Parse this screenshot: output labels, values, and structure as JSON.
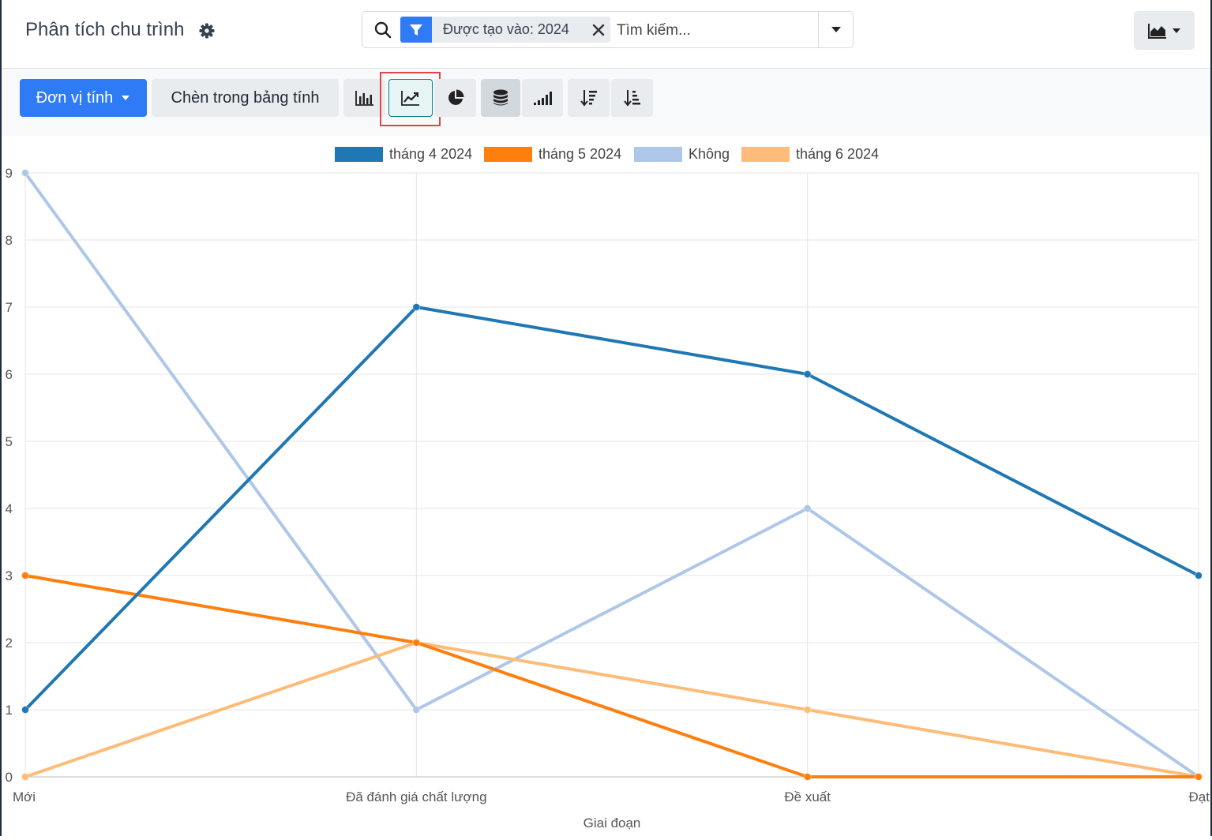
{
  "header": {
    "title": "Phân tích chu trình",
    "search": {
      "facet_label": "Được tạo vào: 2024",
      "placeholder": "Tìm kiếm..."
    }
  },
  "toolbar": {
    "measures_label": "Đơn vị tính",
    "insert_label": "Chèn trong bảng tính"
  },
  "colors": {
    "primary": "#2f7bf6",
    "selected_border": "#017e84",
    "highlight": "#e0454a"
  },
  "chart_data": {
    "type": "line",
    "xlabel": "Giai đoạn",
    "ylabel": "",
    "ylim": [
      0,
      9
    ],
    "yticks": [
      0,
      1,
      2,
      3,
      4,
      5,
      6,
      7,
      8,
      9
    ],
    "categories": [
      "Mới",
      "Đã đánh giá chất lượng",
      "Đề xuất",
      "Đạt"
    ],
    "legend_position": "top-center",
    "grid": true,
    "series": [
      {
        "name": "tháng 4 2024",
        "color": "#1f77b4",
        "values": [
          1,
          7,
          6,
          3
        ]
      },
      {
        "name": "tháng 5 2024",
        "color": "#ff7f0e",
        "values": [
          3,
          2,
          0,
          0
        ]
      },
      {
        "name": "Không",
        "color": "#aec7e8",
        "values": [
          9,
          1,
          4,
          0
        ]
      },
      {
        "name": "tháng 6 2024",
        "color": "#ffbb78",
        "values": [
          0,
          2,
          1,
          0
        ]
      }
    ]
  }
}
